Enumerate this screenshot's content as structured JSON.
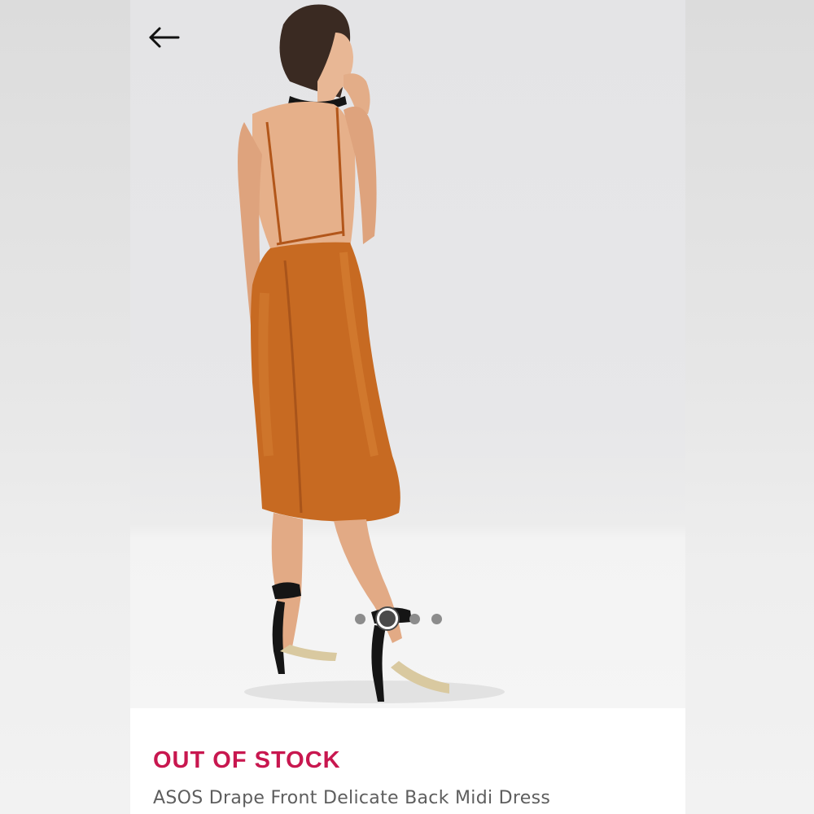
{
  "header": {
    "back_icon": "arrow-left-icon"
  },
  "gallery": {
    "image_description_icon": "product-photo",
    "dress_color": "#c76a22",
    "dots": {
      "count": 4,
      "active_index": 1
    }
  },
  "product": {
    "stock_status": "OUT OF STOCK",
    "stock_color": "#c8174f",
    "title": "ASOS Drape Front Delicate Back Midi Dress"
  }
}
